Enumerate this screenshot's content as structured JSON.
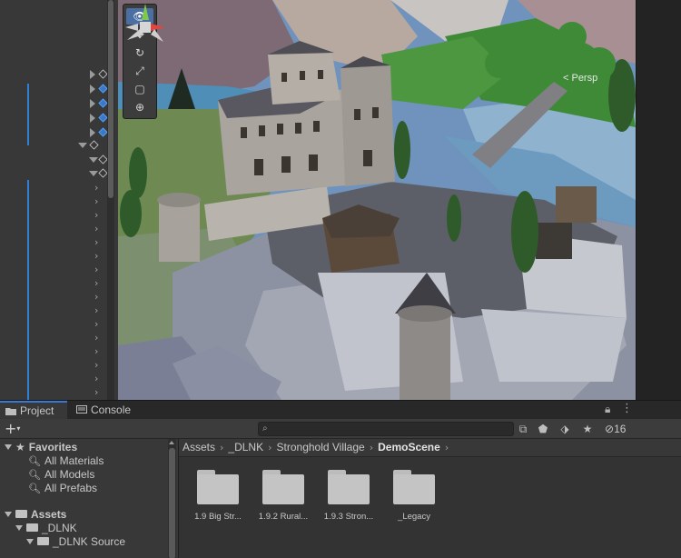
{
  "scene": {
    "persp_label": "< Persp"
  },
  "project_panel": {
    "tabs": [
      {
        "label": "Project",
        "active": true
      },
      {
        "label": "Console",
        "active": false
      }
    ],
    "hidden_count": "16",
    "search": {
      "placeholder": ""
    },
    "favorites": {
      "label": "Favorites",
      "items": [
        "All Materials",
        "All Models",
        "All Prefabs"
      ]
    },
    "assets_tree": {
      "label": "Assets",
      "children": [
        {
          "label": "_DLNK"
        },
        {
          "label": "_DLNK Source"
        }
      ]
    },
    "breadcrumb": [
      "Assets",
      "_DLNK",
      "Stronghold Village",
      "DemoScene"
    ],
    "assets": [
      {
        "label": "1.9 Big Str..."
      },
      {
        "label": "1.9.2 Rural..."
      },
      {
        "label": "1.9.3 Stron..."
      },
      {
        "label": "_Legacy"
      }
    ]
  },
  "colors": {
    "panel_bg": "#383838",
    "dark_bg": "#282828",
    "accent_blue": "#3a79d3",
    "text": "#c8c8c8"
  }
}
